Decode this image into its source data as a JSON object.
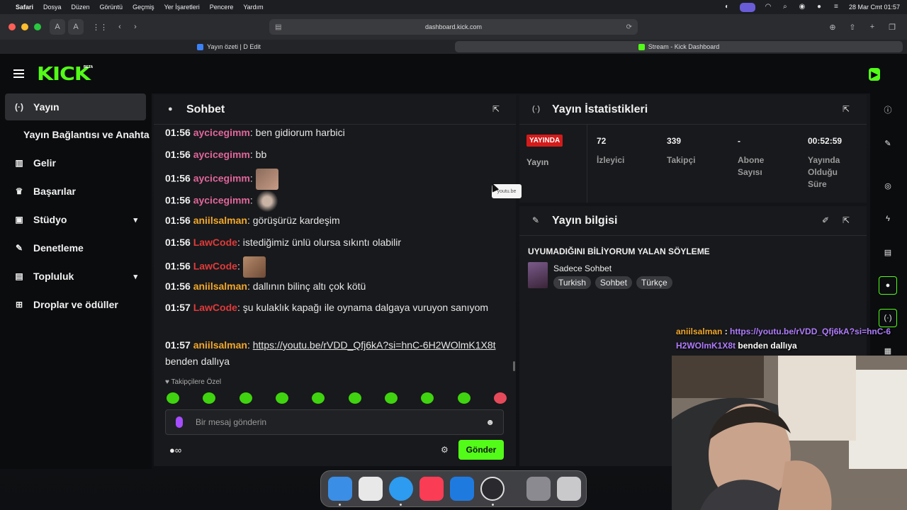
{
  "menubar": {
    "apple": "",
    "app": "Safari",
    "menus": [
      "Dosya",
      "Düzen",
      "Görüntü",
      "Geçmiş",
      "Yer İşaretleri",
      "Pencere",
      "Yardım"
    ],
    "clock": "28 Mar Cmt  01:57"
  },
  "browser": {
    "reader_a_small": "A",
    "reader_a_large": "A",
    "url": "dashboard.kick.com",
    "tabs": [
      {
        "label": "Yayın özeti | D Edit",
        "favicon_color": "#3b82f6"
      },
      {
        "label": "Stream - Kick Dashboard",
        "favicon_color": "#53fc18"
      }
    ]
  },
  "header": {
    "logo": "KICK",
    "badge": "BETA"
  },
  "sidebar": {
    "items": [
      {
        "label": "Yayın",
        "icon": "broadcast-icon",
        "glyph": "(·)",
        "active": true
      },
      {
        "label": "Yayın Bağlantısı ve Anahta",
        "icon": "",
        "glyph": ""
      },
      {
        "label": "Gelir",
        "icon": "chart-icon",
        "glyph": "▥"
      },
      {
        "label": "Başarılar",
        "icon": "trophy-icon",
        "glyph": "🏆"
      },
      {
        "label": "Stüdyo",
        "icon": "studio-icon",
        "glyph": "▣",
        "expandable": true
      },
      {
        "label": "Denetleme",
        "icon": "wrench-icon",
        "glyph": "🔧"
      },
      {
        "label": "Topluluk",
        "icon": "community-icon",
        "glyph": "▤",
        "expandable": true
      },
      {
        "label": "Droplar ve ödüller",
        "icon": "gift-icon",
        "glyph": "🎁"
      }
    ]
  },
  "chat": {
    "title": "Sohbet",
    "messages": [
      {
        "time": "01:56",
        "user": "aycicegimm",
        "color": "#e0669c",
        "text": "ben gidiorum harbici"
      },
      {
        "time": "01:56",
        "user": "aycicegimm",
        "color": "#e0669c",
        "text": "bb"
      },
      {
        "time": "01:56",
        "user": "aycicegimm",
        "color": "#e0669c",
        "text": "",
        "emote": true
      },
      {
        "time": "01:56",
        "user": "aycicegimm",
        "color": "#e0669c",
        "text": "",
        "emote": true
      },
      {
        "time": "01:56",
        "user": "aniilsalman",
        "color": "#f2a82b",
        "text": "görüşürüz kardeşim"
      },
      {
        "time": "01:56",
        "user": "LawCode",
        "color": "#e03a3a",
        "text": "istediğimiz ünlü olursa sıkıntı olabilir"
      },
      {
        "time": "01:56",
        "user": "LawCode",
        "color": "#e03a3a",
        "text": "",
        "emote": true
      },
      {
        "time": "01:56",
        "user": "aniilsalman",
        "color": "#f2a82b",
        "text": "dallının bilinç altı çok kötü"
      },
      {
        "time": "01:57",
        "user": "LawCode",
        "color": "#e03a3a",
        "text": "şu kulaklık kapağı ile oynama dalgaya vuruyon sanıyom"
      },
      {
        "time": "01:57",
        "user": "aniilsalman",
        "color": "#f2a82b",
        "text": " benden dallıya",
        "link": "https://youtu.be/rVDD_Qfj6kA?si=hnC-6H2WOlmK1X8t"
      }
    ],
    "followers_only": "Takipçilere Özel",
    "placeholder": "Bir mesaj gönderin",
    "send": "Gönder",
    "footer_left": "●∞"
  },
  "stats": {
    "title": "Yayın İstatistikleri",
    "live_badge": "YAYINDA",
    "live_label": "Yayın",
    "items": [
      {
        "value": "72",
        "label": "İzleyici"
      },
      {
        "value": "339",
        "label": "Takipçi"
      },
      {
        "value": "-",
        "label": "Abone Sayısı"
      },
      {
        "value": "00:52:59",
        "label": "Yayında Olduğu Süre"
      }
    ]
  },
  "info": {
    "title": "Yayın bilgisi",
    "stream_title": "UYUMADIĞINI BİLİYORUM YALAN SÖYLEME",
    "category": "Sadece Sohbet",
    "tags": [
      "Turkish",
      "Sohbet",
      "Türkçe"
    ]
  },
  "tooltip": "youtu.be",
  "overlay": {
    "user": "aniilsalman",
    "sep": " : ",
    "link": "https://youtu.be/rVDD_Qfj6kA?si=hnC-6H2WOlmK1X8t",
    "text": " benden dallıya"
  },
  "dock": {
    "apps": [
      {
        "name": "finder",
        "color": "#3a8ee6"
      },
      {
        "name": "launchpad",
        "color": "#e8e8e8"
      },
      {
        "name": "safari",
        "color": "#2d9bf0"
      },
      {
        "name": "music",
        "color": "#fa3c55"
      },
      {
        "name": "xcode",
        "color": "#1f7ae0"
      },
      {
        "name": "obs",
        "color": "#2a2a2e"
      },
      {
        "name": "downloads",
        "color": "#8a8a90"
      },
      {
        "name": "trash",
        "color": "#c9c9cc"
      }
    ]
  }
}
